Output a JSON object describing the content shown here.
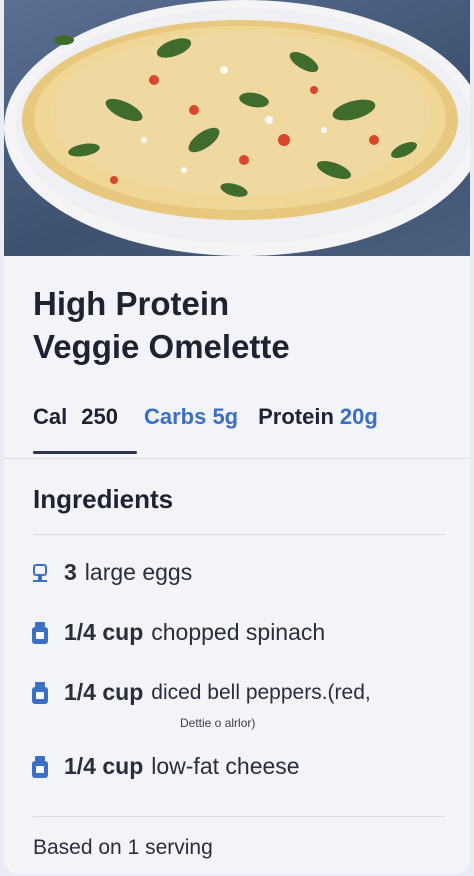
{
  "recipe": {
    "title_line1": "High Protein",
    "title_line2": "Veggie Omelette"
  },
  "stats": {
    "cal_label": "Cal",
    "cal_value": "250",
    "carbs_label": "Carbs 5g",
    "protein_label": "Protein",
    "protein_value": "20g"
  },
  "ingredients": {
    "heading": "Ingredients",
    "items": [
      {
        "qty": "3",
        "text": "large eggs",
        "icon": "egg-icon"
      },
      {
        "qty": "1/4 cup",
        "text": "chopped spinach",
        "icon": "container-icon"
      },
      {
        "qty": "1/4 cup",
        "text": "diced bell peppers.(red,",
        "icon": "container-icon"
      },
      {
        "qty": "1/4 cup",
        "text": "low-fat cheese",
        "icon": "container-icon"
      }
    ],
    "note": "Dettie o alrlor)"
  },
  "footer": {
    "serving_text": "Based on 1 serving"
  },
  "colors": {
    "accent": "#3b6fc4",
    "text": "#1f2230",
    "card_bg": "#f3f4f8"
  }
}
